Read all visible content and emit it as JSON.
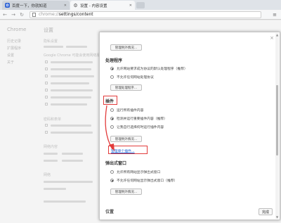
{
  "browser": {
    "tabs": [
      {
        "title": "百度一下，你就知道",
        "icon": "baidu-paw-icon",
        "active": false
      },
      {
        "title": "设置 - 内容设置",
        "icon": "gear-icon",
        "active": true
      }
    ],
    "url_host": "chrome://",
    "url_path": "settings/content"
  },
  "background": {
    "sidebar_title": "Chrome",
    "sidebar_items": [
      "历史记录",
      "扩展程序",
      "设置",
      "关于"
    ],
    "page_title": "设置",
    "sections": [
      {
        "label": "隐私设置",
        "lines": [
          "内容设置…",
          "清除浏览数据…"
        ]
      },
      {
        "label": "Google Chrome 可能会使用网络服务来改善您的浏览体验。"
      },
      {
        "label": "密码和表单"
      },
      {
        "label": "网络内容"
      },
      {
        "label": "网络"
      }
    ]
  },
  "dialog": {
    "close_label": "×",
    "top_button": "管理例外情况…",
    "handlers": {
      "title": "处理程序",
      "options": [
        {
          "label": "允许网站要求成为协议的默认处理程序（推荐）",
          "selected": true
        },
        {
          "label": "不允许任何网站处理协议",
          "selected": false
        }
      ],
      "button": "管理处理程序…"
    },
    "plugins": {
      "title": "插件",
      "options": [
        {
          "label": "运行所有插件内容",
          "selected": false
        },
        {
          "label": "检测并运行重要插件内容（推荐）",
          "selected": true
        },
        {
          "label": "让我自行选择何时运行插件内容",
          "selected": false
        }
      ],
      "button": "管理例外情况…",
      "link": "管理单个插件…"
    },
    "popups": {
      "title": "弹出式窗口",
      "options": [
        {
          "label": "允许所有网站显示弹出式窗口",
          "selected": false
        },
        {
          "label": "不允许任何网站显示弹出式窗口（推荐）",
          "selected": true
        }
      ],
      "button": "管理例外情况…"
    },
    "bottom_section": "位置",
    "done_button": "完成"
  },
  "annotation_color": "#e23b3b"
}
